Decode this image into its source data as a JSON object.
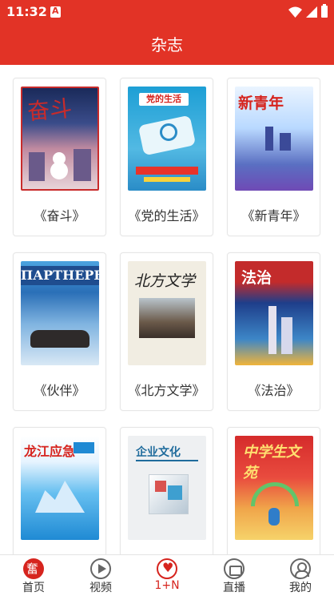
{
  "status_bar": {
    "time": "11:32",
    "sim_icon": "sim-card-icon",
    "icons": [
      "wifi-icon",
      "signal-icon",
      "battery-icon"
    ]
  },
  "header": {
    "title": "杂志"
  },
  "magazines": [
    {
      "label": "《奋斗》",
      "cover_title": "奋斗"
    },
    {
      "label": "《党的生活》",
      "cover_title": "党的生活"
    },
    {
      "label": "《新青年》",
      "cover_title": "新青年"
    },
    {
      "label": "《伙伴》",
      "cover_title": "ПАРТНЕРЫ"
    },
    {
      "label": "《北方文学》",
      "cover_title": "北方文学"
    },
    {
      "label": "《法治》",
      "cover_title": "法治"
    },
    {
      "label": "",
      "cover_title": "龙江应急"
    },
    {
      "label": "",
      "cover_title": "企业文化"
    },
    {
      "label": "",
      "cover_title": "中学生文苑"
    }
  ],
  "bottom_nav": [
    {
      "label": "首页",
      "icon": "home-logo-icon"
    },
    {
      "label": "视频",
      "icon": "play-icon"
    },
    {
      "label": "1+N",
      "icon": "heart-icon",
      "active": true
    },
    {
      "label": "直播",
      "icon": "camera-icon"
    },
    {
      "label": "我的",
      "icon": "user-icon"
    }
  ],
  "colors": {
    "brand": "#e23326",
    "active": "#d6241e"
  }
}
